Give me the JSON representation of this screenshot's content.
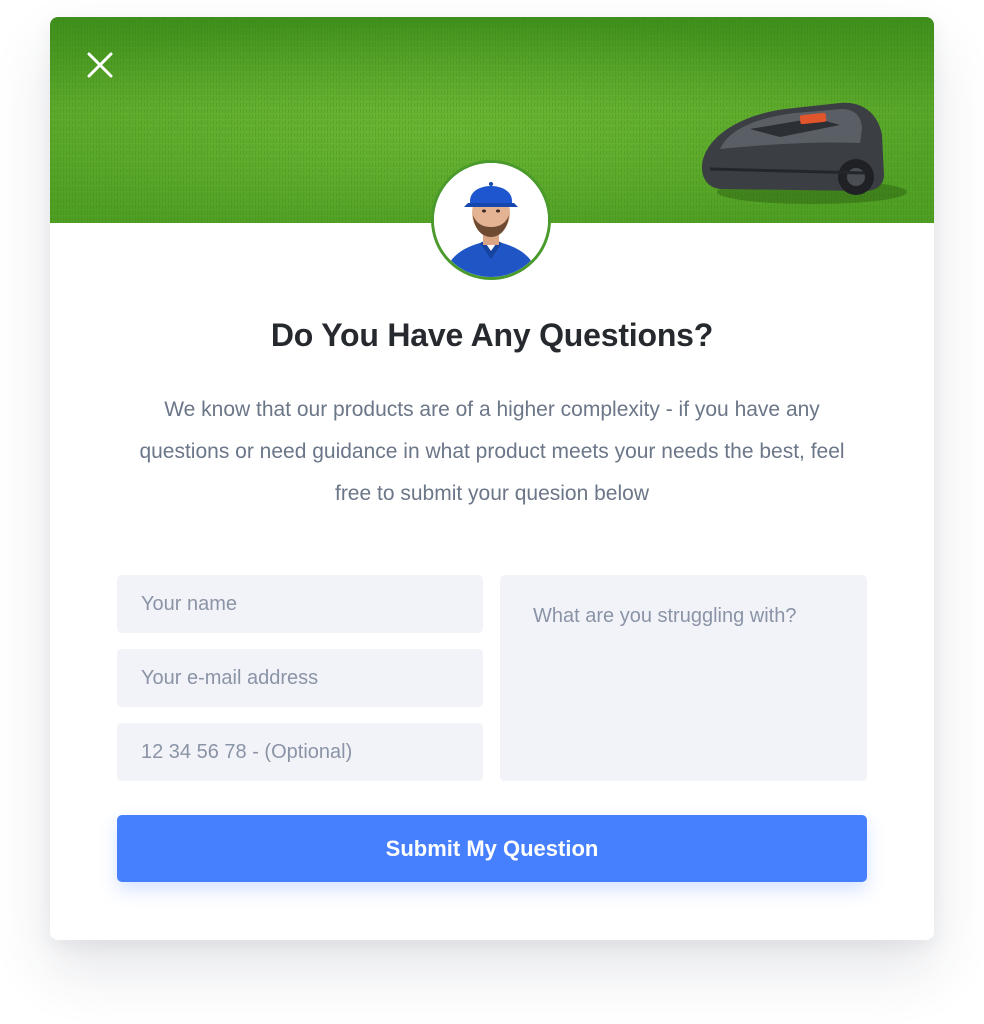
{
  "dialog": {
    "title": "Do You Have Any Questions?",
    "description": "We know that our products are of a higher complexity - if you have any questions or need guidance in what product meets your needs the best, feel free to submit your quesion below",
    "close_icon": "close-icon"
  },
  "form": {
    "name_placeholder": "Your name",
    "email_placeholder": "Your e-mail address",
    "phone_placeholder": "12 34 56 78 - (Optional)",
    "question_placeholder": "What are you struggling with?",
    "submit_label": "Submit My Question"
  },
  "colors": {
    "accent": "#4680ff",
    "avatar_ring": "#4a9a2c",
    "field_bg": "#f2f3f8",
    "title": "#262a2e",
    "body_text": "#6b7688"
  }
}
